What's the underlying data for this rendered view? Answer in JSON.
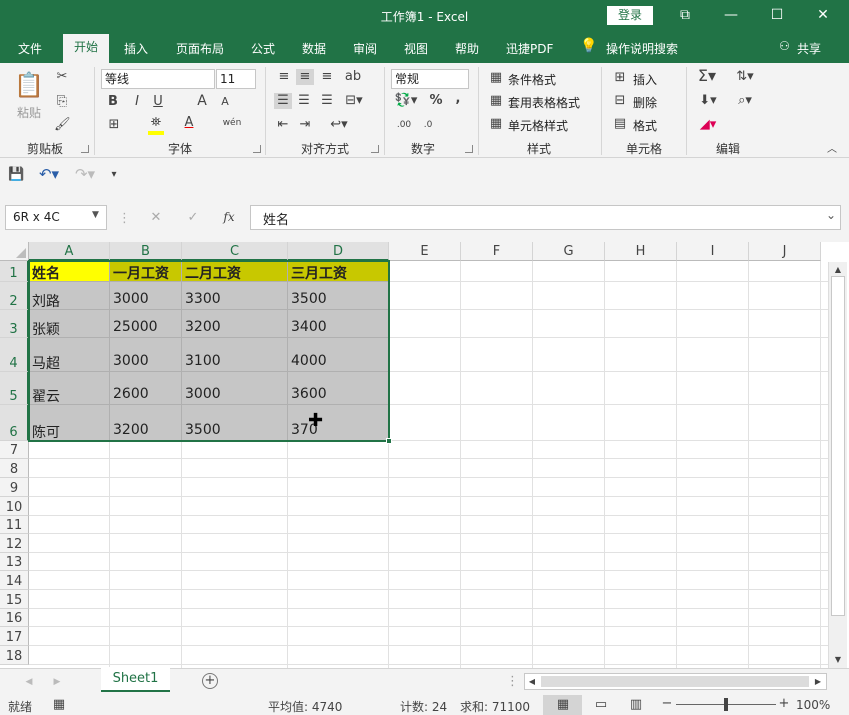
{
  "window": {
    "title": "工作簿1  -  Excel",
    "login_label": "登录",
    "buttons": {
      "ribbon_display": "⧉",
      "minimize": "—",
      "maximize": "☐",
      "close": "✕"
    }
  },
  "tabs": {
    "file": "文件",
    "home": "开始",
    "insert": "插入",
    "layout": "页面布局",
    "formulas": "公式",
    "data": "数据",
    "review": "审阅",
    "view": "视图",
    "help": "帮助",
    "pdf": "迅捷PDF",
    "tell_me": "操作说明搜索",
    "share": "共享"
  },
  "ribbon": {
    "clipboard": {
      "label": "剪贴板",
      "paste": "粘贴"
    },
    "font": {
      "label": "字体",
      "name": "等线",
      "size": "11",
      "bold": "B",
      "italic": "I",
      "underline": "U",
      "grow": "A",
      "shrink": "A",
      "phonetic": "wén",
      "fill_letter": "",
      "color_letter": "A"
    },
    "alignment": {
      "label": "对齐方式"
    },
    "number": {
      "label": "数字",
      "format": "常规",
      "percent": "%",
      "comma": ","
    },
    "styles": {
      "label": "样式",
      "conditional": "条件格式",
      "table": "套用表格格式",
      "cell": "单元格样式"
    },
    "cells": {
      "label": "单元格",
      "insert": "插入",
      "delete": "删除",
      "format": "格式"
    },
    "editing": {
      "label": "编辑"
    }
  },
  "formula_bar": {
    "name_box": "6R x 4C",
    "fx": "fx",
    "value": "姓名"
  },
  "columns": [
    "A",
    "B",
    "C",
    "D",
    "E",
    "F",
    "G",
    "H",
    "I",
    "J"
  ],
  "rows": [
    "1",
    "2",
    "3",
    "4",
    "5",
    "6",
    "7",
    "8",
    "9",
    "10",
    "11",
    "12",
    "13",
    "14",
    "15",
    "16",
    "17",
    "18"
  ],
  "table": [
    [
      "姓名",
      "一月工资",
      "二月工资",
      "三月工资"
    ],
    [
      "刘路",
      "3000",
      "3300",
      "3500"
    ],
    [
      "张颖",
      "25000",
      "3200",
      "3400"
    ],
    [
      "马超",
      "3000",
      "3100",
      "4000"
    ],
    [
      "翟云",
      "2600",
      "3000",
      "3600"
    ],
    [
      "陈可",
      "3200",
      "3500",
      "370"
    ]
  ],
  "sheets": {
    "active": "Sheet1",
    "add": "+"
  },
  "status": {
    "ready": "就绪",
    "average": "平均值: 4740",
    "count": "计数: 24",
    "sum": "求和: 71100",
    "zoom": "100%"
  },
  "colors": {
    "accent": "#217346",
    "header_fill": "#c8c800",
    "name_fill": "#ffff00",
    "selection_fill": "#c6c6c6"
  }
}
